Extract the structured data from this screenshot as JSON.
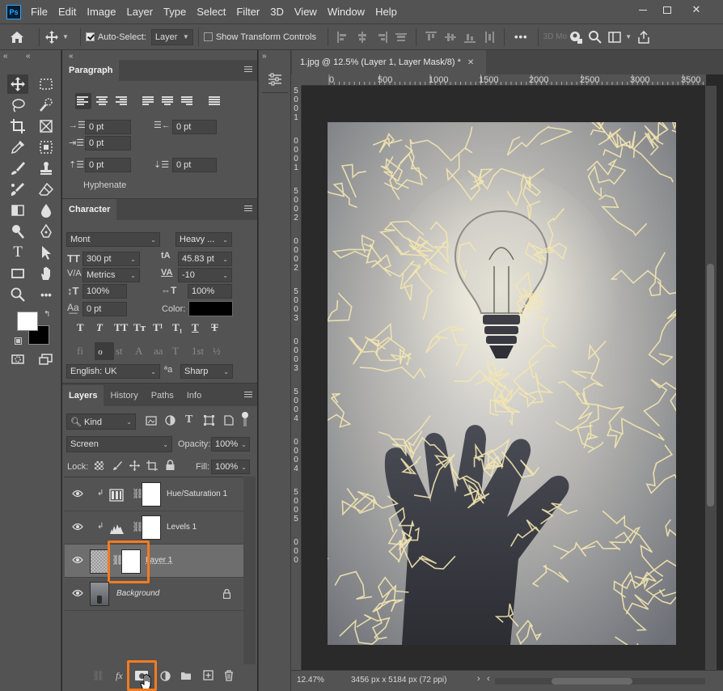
{
  "app": {
    "logo": "Ps",
    "menu": [
      "File",
      "Edit",
      "Image",
      "Layer",
      "Type",
      "Select",
      "Filter",
      "3D",
      "View",
      "Window",
      "Help"
    ]
  },
  "options": {
    "auto_select_label": "Auto-Select:",
    "auto_select_value": "Layer",
    "show_transform_label": "Show Transform Controls",
    "more_label": "•••",
    "mode_3d_label": "3D Mo"
  },
  "paragraph": {
    "tab": "Paragraph",
    "indent_left": "0 pt",
    "indent_right": "0 pt",
    "indent_first": "0 pt",
    "space_before": "0 pt",
    "space_after": "0 pt",
    "hyphenate_label": "Hyphenate"
  },
  "character": {
    "tab": "Character",
    "font_family": "Mont",
    "font_style": "Heavy ...",
    "font_size": "300 pt",
    "leading": "45.83 pt",
    "kerning": "Metrics",
    "tracking": "-10",
    "vertical_scale": "100%",
    "horizontal_scale": "100%",
    "baseline_shift": "0 pt",
    "color_label": "Color:",
    "color_value": "#000000",
    "language": "English: UK",
    "antialias_prefix": "ªa",
    "antialias": "Sharp",
    "style_buttons": [
      "T",
      "T",
      "TT",
      "Tт",
      "T¹",
      "T₁",
      "T",
      "T"
    ],
    "opentype_buttons": [
      "fi",
      "ℴ",
      "st",
      "A",
      "aa",
      "T",
      "1st",
      "½"
    ]
  },
  "layers": {
    "tabs": [
      "Layers",
      "History",
      "Paths",
      "Info"
    ],
    "filter_label": "Kind",
    "blend_mode": "Screen",
    "opacity_label": "Opacity:",
    "opacity_value": "100%",
    "lock_label": "Lock:",
    "fill_label": "Fill:",
    "fill_value": "100%",
    "items": [
      {
        "name": "Hue/Saturation 1"
      },
      {
        "name": "Levels 1"
      },
      {
        "name": "Layer 1"
      },
      {
        "name": "Background"
      }
    ],
    "bottom_fx": "fx"
  },
  "document": {
    "tab_title": "1.jpg @ 12.5% (Layer 1, Layer Mask/8) *",
    "ruler_h": [
      "0",
      "500",
      "1000",
      "1500",
      "2000",
      "2500",
      "3000",
      "3500"
    ],
    "ruler_v": [
      "5",
      "0",
      "0",
      "1",
      "0",
      "0",
      "0",
      "1",
      "5",
      "0",
      "0",
      "2",
      "0",
      "0",
      "0",
      "2",
      "5",
      "0",
      "0",
      "3",
      "0",
      "0",
      "0",
      "3",
      "5",
      "0",
      "0",
      "4",
      "0",
      "0",
      "0",
      "4",
      "5",
      "0",
      "0",
      "5",
      "0",
      "0",
      "0"
    ],
    "zoom": "12.47%",
    "doc_info": "3456 px x 5184 px (72 ppi)"
  },
  "colors": {
    "accent": "#f47b20",
    "panel": "#535353",
    "dark": "#282828"
  }
}
